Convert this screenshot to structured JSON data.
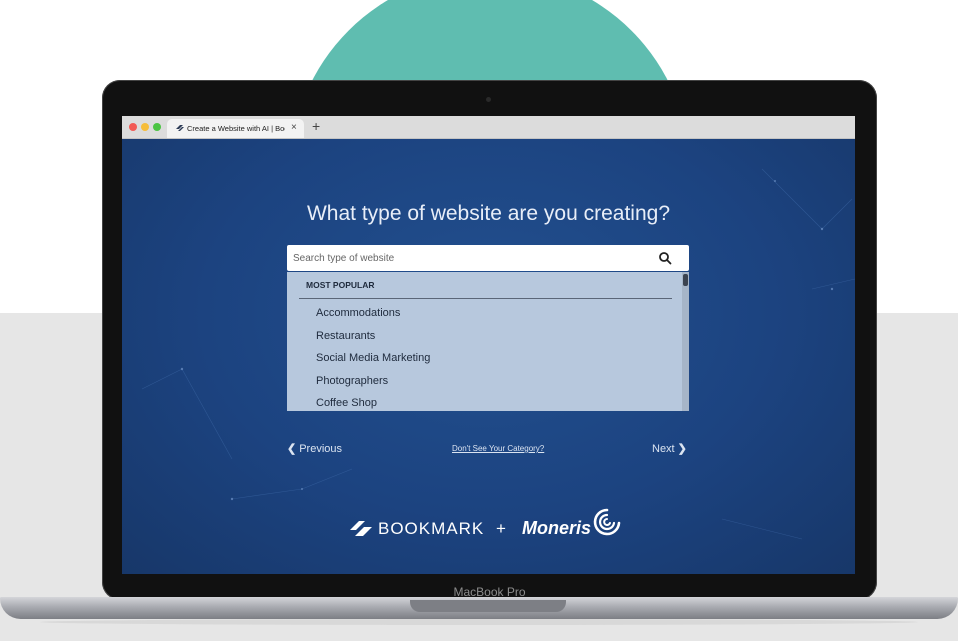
{
  "browser": {
    "tab_title": "Create a Website with AI | Bookmark",
    "tab_close": "×",
    "new_tab": "+"
  },
  "page": {
    "heading": "What type of website are you creating?",
    "search": {
      "placeholder": "Search type of website",
      "value": ""
    },
    "dropdown": {
      "section_title": "MOST POPULAR",
      "items": [
        "Accommodations",
        "Restaurants",
        "Social Media Marketing",
        "Photographers",
        "Coffee Shop"
      ]
    },
    "nav": {
      "previous": "Previous",
      "dont_see_category": "Don't See Your Category?",
      "next": "Next"
    },
    "brands": {
      "bookmark": "BOOKMARK",
      "plus": "+",
      "moneris": "Moneris"
    }
  },
  "device": {
    "label": "MacBook Pro"
  },
  "colors": {
    "teal_circle": "#5fbdb0",
    "page_background": "#1f4582",
    "dropdown_background": "#b7c8dd",
    "heading_text": "#e8eef8"
  }
}
